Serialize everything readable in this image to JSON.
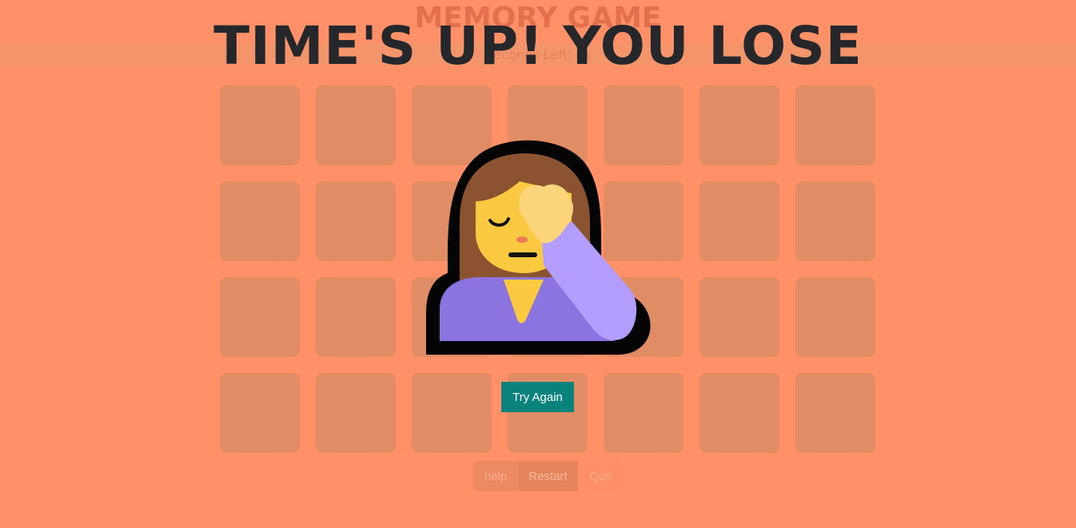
{
  "game": {
    "title": "MEMORY GAME",
    "timer_text": "Seconds Left: 0s",
    "card_count": 28
  },
  "overlay": {
    "message": "TIME'S UP! YOU LOSE",
    "emoji_icon": "woman-facepalming-icon",
    "try_again_label": "Try Again"
  },
  "controls": {
    "help_label": "help",
    "restart_label": "Restart",
    "quit_label": "Quit"
  },
  "colors": {
    "background": "#ff9068",
    "card": "#e08d66",
    "try_again_button": "#09837b",
    "overlay_text": "#25272b"
  }
}
